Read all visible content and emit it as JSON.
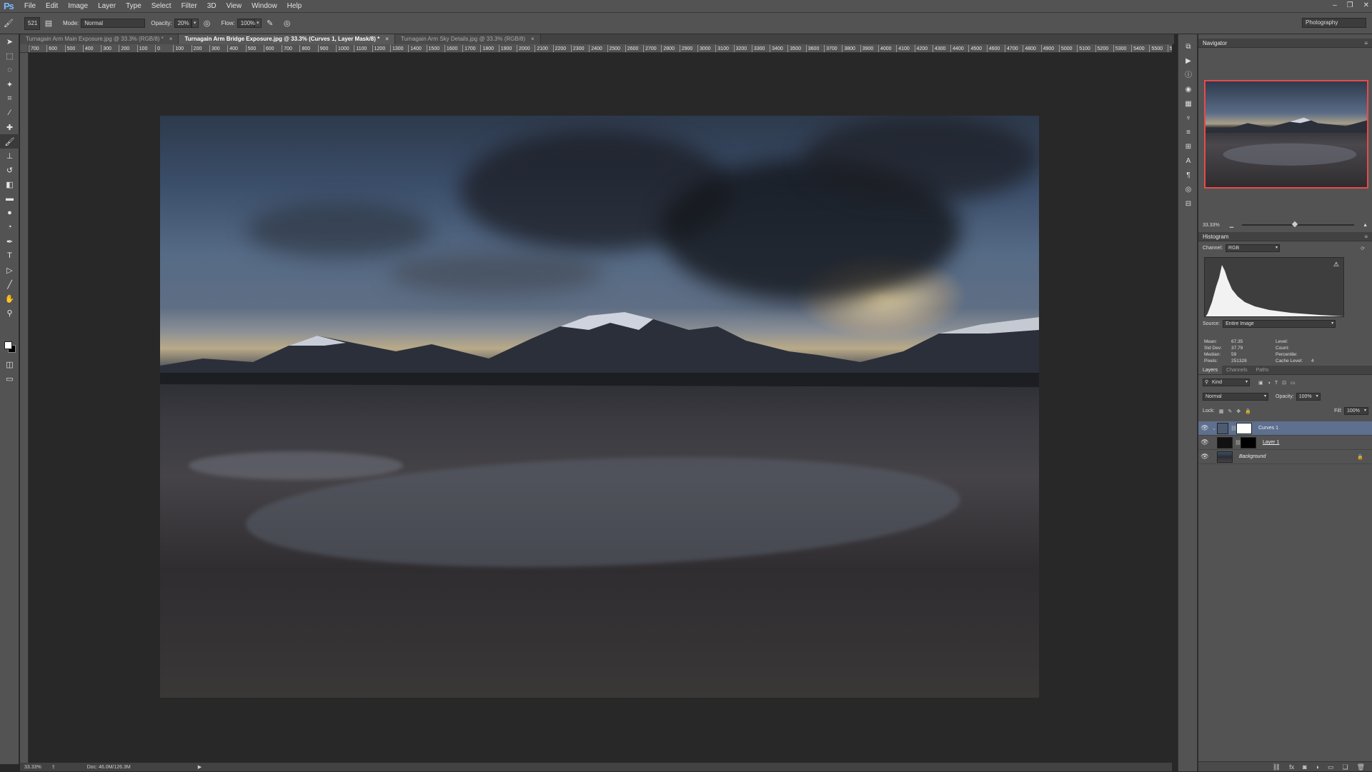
{
  "app": {
    "logo": "Ps"
  },
  "menu": [
    "File",
    "Edit",
    "Image",
    "Layer",
    "Type",
    "Select",
    "Filter",
    "3D",
    "View",
    "Window",
    "Help"
  ],
  "window_controls": [
    "–",
    "❐",
    "✕"
  ],
  "options": {
    "brush_size": "521",
    "mode_label": "Mode:",
    "mode_value": "Normal",
    "opacity_label": "Opacity:",
    "opacity_value": "20%",
    "flow_label": "Flow:",
    "flow_value": "100%",
    "workspace": "Photography"
  },
  "tabs": [
    {
      "label": "Turnagain Arm Main Exposure.jpg @ 33.3% (RGB/8) *",
      "active": false
    },
    {
      "label": "Turnagain Arm Bridge Exposure.jpg @ 33.3% (Curves 1, Layer Mask/8) *",
      "active": true
    },
    {
      "label": "Turnagain Arm Sky Details.jpg @ 33.3% (RGB/8)",
      "active": false
    }
  ],
  "ruler_ticks": [
    "700",
    "600",
    "500",
    "400",
    "300",
    "200",
    "100",
    "0",
    "100",
    "200",
    "300",
    "400",
    "500",
    "600",
    "700",
    "800",
    "900",
    "1000",
    "1100",
    "1200",
    "1300",
    "1400",
    "1500",
    "1600",
    "1700",
    "1800",
    "1900",
    "2000",
    "2100",
    "2200",
    "2300",
    "2400",
    "2500",
    "2600",
    "2700",
    "2800",
    "2900",
    "3000",
    "3100",
    "3200",
    "3300",
    "3400",
    "3500",
    "3600",
    "3700",
    "3800",
    "3900",
    "4000",
    "4100",
    "4200",
    "4300",
    "4400",
    "4500",
    "4600",
    "4700",
    "4800",
    "4900",
    "5000",
    "5100",
    "5200",
    "5300",
    "5400",
    "5500",
    "5600"
  ],
  "status": {
    "zoom": "33.33%",
    "doc": "Doc: 46.0M/126.3M"
  },
  "navigator": {
    "title": "Navigator",
    "zoom": "33.33%"
  },
  "histogram": {
    "title": "Histogram",
    "channel_label": "Channel:",
    "channel_value": "RGB",
    "source_label": "Source:",
    "source_value": "Entire Image",
    "stats": [
      [
        "Mean:",
        "67.35",
        "Level:",
        ""
      ],
      [
        "Std Dev:",
        "37.79",
        "Count:",
        ""
      ],
      [
        "Median:",
        "59",
        "Percentile:",
        ""
      ],
      [
        "Pixels:",
        "251328",
        "Cache Level:",
        "4"
      ]
    ]
  },
  "layers": {
    "tabs": [
      "Layers",
      "Channels",
      "Paths"
    ],
    "filter": "Kind",
    "blend": "Normal",
    "opacity_label": "Opacity:",
    "opacity_value": "100%",
    "lock_label": "Lock:",
    "fill_label": "Fill:",
    "fill_value": "100%",
    "rows": [
      {
        "name": "Curves 1",
        "selected": true
      },
      {
        "name": "Layer 1",
        "selected": false
      },
      {
        "name": "Background",
        "selected": false
      }
    ]
  },
  "colors": {
    "accent": "#e84a4a",
    "selection": "#5e6f8f",
    "chrome": "#535353"
  }
}
